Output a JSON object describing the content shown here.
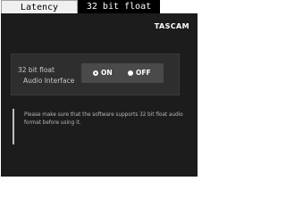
{
  "tabs": {
    "latency": "Latency",
    "bit32": "32 bit float"
  },
  "logo": "TASCAM",
  "setting": {
    "label_line1": "32 bit float",
    "label_line2": "Audio Interface",
    "options": [
      {
        "label": "ON",
        "selected": true
      },
      {
        "label": "OFF",
        "selected": false
      }
    ]
  },
  "note": {
    "text": "Please make sure that the software supports 32 bit float audio format before using it."
  },
  "colors": {
    "panel_bg": "#1c1c1c",
    "active_tab_bg": "#000000",
    "radio_group_bg": "#4a4a4a"
  }
}
